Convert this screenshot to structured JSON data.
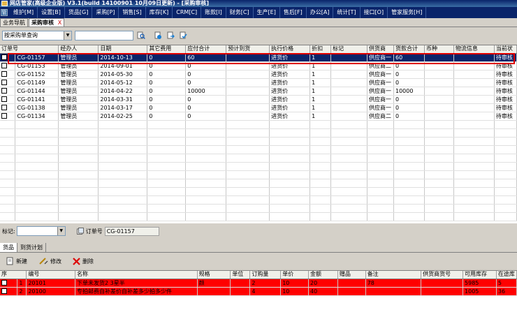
{
  "app": {
    "title": "网店管家(高级企业版) V3.1(build 14100901 10月09日更新) - [采购审核]"
  },
  "menu": {
    "logo": "管",
    "items": [
      "维护[M]",
      "设置[B]",
      "货品[G]",
      "采购[P]",
      "销售[S]",
      "库存[K]",
      "CRM[C]",
      "账款[I]",
      "财务[C]",
      "生产[E]",
      "售后[F]",
      "办公[A]",
      "统计[T]",
      "接口[O]",
      "管家服务[H]"
    ]
  },
  "tabs": [
    {
      "label": "业务导航"
    },
    {
      "label": "采购审核",
      "close": "X"
    }
  ],
  "toolbar": {
    "query_type": "按采购单查询",
    "search_value": "",
    "search_placeholder": ""
  },
  "main_grid": {
    "columns": [
      "订单号",
      "经办人",
      "日期",
      "其它费用",
      "应付合计",
      "预计到货",
      "执行价格",
      "折扣",
      "标记",
      "供货商",
      "货款合计",
      "币种",
      "物流信息",
      "当前状"
    ],
    "rows": [
      {
        "order_no": "CG-01157",
        "handler": "管理员",
        "date": "2014-10-13",
        "other_fee": "0",
        "payable": "60",
        "eta": "",
        "price_type": "进货价",
        "discount": "1",
        "mark": "",
        "supplier": "供应商一",
        "goods_total": "60",
        "currency": "",
        "logistics": "",
        "status": "待审核",
        "selected": true
      },
      {
        "order_no": "CG-01153",
        "handler": "管理员",
        "date": "2014-09-01",
        "other_fee": "0",
        "payable": "0",
        "eta": "",
        "price_type": "进货价",
        "discount": "1",
        "mark": "",
        "supplier": "供应商二",
        "goods_total": "0",
        "currency": "",
        "logistics": "",
        "status": "待审核"
      },
      {
        "order_no": "CG-01152",
        "handler": "管理员",
        "date": "2014-05-30",
        "other_fee": "0",
        "payable": "0",
        "eta": "",
        "price_type": "进货价",
        "discount": "1",
        "mark": "",
        "supplier": "供应商一",
        "goods_total": "0",
        "currency": "",
        "logistics": "",
        "status": "待审核"
      },
      {
        "order_no": "CG-01149",
        "handler": "管理员",
        "date": "2014-05-12",
        "other_fee": "0",
        "payable": "0",
        "eta": "",
        "price_type": "进货价",
        "discount": "1",
        "mark": "",
        "supplier": "供应商一",
        "goods_total": "0",
        "currency": "",
        "logistics": "",
        "status": "待审核"
      },
      {
        "order_no": "CG-01144",
        "handler": "管理员",
        "date": "2014-04-22",
        "other_fee": "0",
        "payable": "10000",
        "eta": "",
        "price_type": "进货价",
        "discount": "1",
        "mark": "",
        "supplier": "供应商一",
        "goods_total": "10000",
        "currency": "",
        "logistics": "",
        "status": "待审核"
      },
      {
        "order_no": "CG-01141",
        "handler": "管理员",
        "date": "2014-03-31",
        "other_fee": "0",
        "payable": "0",
        "eta": "",
        "price_type": "进货价",
        "discount": "1",
        "mark": "",
        "supplier": "供应商一",
        "goods_total": "0",
        "currency": "",
        "logistics": "",
        "status": "待审核"
      },
      {
        "order_no": "CG-01138",
        "handler": "管理员",
        "date": "2014-03-17",
        "other_fee": "0",
        "payable": "0",
        "eta": "",
        "price_type": "进货价",
        "discount": "1",
        "mark": "",
        "supplier": "供应商一",
        "goods_total": "0",
        "currency": "",
        "logistics": "",
        "status": "待审核"
      },
      {
        "order_no": "CG-01134",
        "handler": "管理员",
        "date": "2014-02-25",
        "other_fee": "0",
        "payable": "0",
        "eta": "",
        "price_type": "进货价",
        "discount": "1",
        "mark": "",
        "supplier": "供应商二",
        "goods_total": "0",
        "currency": "",
        "logistics": "",
        "status": "待审核"
      }
    ]
  },
  "filter": {
    "mark_label": "标记:",
    "mark_value": "",
    "order_label": "订单号",
    "order_value": "CG-01157"
  },
  "subtabs": [
    {
      "label": "货品"
    },
    {
      "label": "到货计划"
    }
  ],
  "subtoolbar": {
    "new_label": "新建",
    "edit_label": "修改",
    "delete_label": "删除"
  },
  "detail_grid": {
    "columns": [
      "序",
      "编号",
      "名称",
      "规格",
      "单位",
      "订购量",
      "单价",
      "金额",
      "赠品",
      "备注",
      "供货商货号",
      "可用库存",
      "在途库"
    ],
    "rows": [
      {
        "seq": "1",
        "code": "20101",
        "name": "下单未发货2 3星半",
        "spec": "颜",
        "unit": "",
        "qty": "2",
        "price": "10",
        "amount": "20",
        "gift": "",
        "remark": "78",
        "supplier_code": "",
        "available": "5985",
        "in_transit": "5"
      },
      {
        "seq": "2",
        "code": "20100",
        "name": "专拍邮费自补差价自补差多少拍多少件",
        "spec": "",
        "unit": "",
        "qty": "4",
        "price": "10",
        "amount": "40",
        "gift": "",
        "remark": "",
        "supplier_code": "",
        "available": "1005",
        "in_transit": "36"
      }
    ]
  },
  "colors": {
    "menubar": "#0a246a",
    "selection": "#0a246a",
    "highlight_row": "#ff0000",
    "annotation_box": "#e00000"
  }
}
